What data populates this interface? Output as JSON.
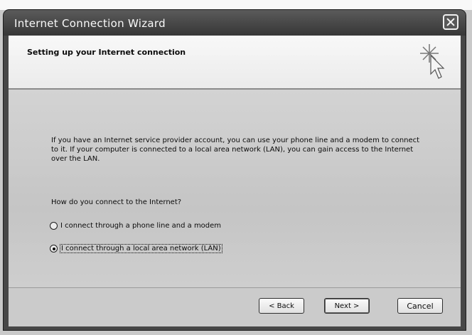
{
  "window": {
    "title": "Internet Connection Wizard"
  },
  "header": {
    "title": "Setting up your Internet connection",
    "icon": "wizard-wand-icon"
  },
  "body": {
    "description": "If you have an Internet service provider account, you can use your phone line and a modem to connect to it. If your computer is connected to a local area network (LAN), you can gain access to the Internet over the LAN.",
    "question": "How do you connect to the Internet?",
    "options": [
      {
        "label": "I connect through a phone line and a modem",
        "selected": false
      },
      {
        "label": "I connect through a local area network (LAN)",
        "selected": true
      }
    ]
  },
  "buttons": {
    "back": "< Back",
    "next": "Next >",
    "cancel": "Cancel"
  }
}
